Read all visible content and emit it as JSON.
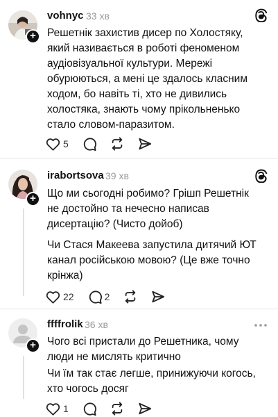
{
  "posts": [
    {
      "username": "vohnyc",
      "time": "33 хв",
      "paragraphs": [
        "Решетнік захистив дисер по Холостяку,\nякий називається в роботі феноменом\nаудіовізуальної культури. Мережі\nобурюються, а мені це здалось класним\nходом, бо навіть ті, хто не дивились\nхолостяка, знають чому прікольненько\nстало словом-паразитом."
      ],
      "likes": "5",
      "replies": ""
    },
    {
      "username": "irabortsova",
      "time": "39 хв",
      "paragraphs": [
        "Що ми сьогодні робимо? Грішп Решетнік\nне достойно та нечесно написав\nдисертацію? (Чисто дойоб)",
        "Чи Стася Макеева запустила дитячий ЮТ\nканал російською мовою? (Це вже точно\nкрінжа)"
      ],
      "likes": "22",
      "replies": "2"
    },
    {
      "username": "ffffrolik",
      "time": "36 хв",
      "paragraphs": [
        "Чого всі пристали до Решетника, чому\nлюди не мислять критично",
        "Чи їм так стає легше, принижуючи когось,\nхто чогось досяг"
      ],
      "likes": "1",
      "replies": ""
    }
  ],
  "icons": {
    "threads": "threads-logo-icon",
    "like": "heart-icon",
    "reply": "comment-icon",
    "repost": "repost-icon",
    "share": "send-icon",
    "more": "more-icon"
  }
}
